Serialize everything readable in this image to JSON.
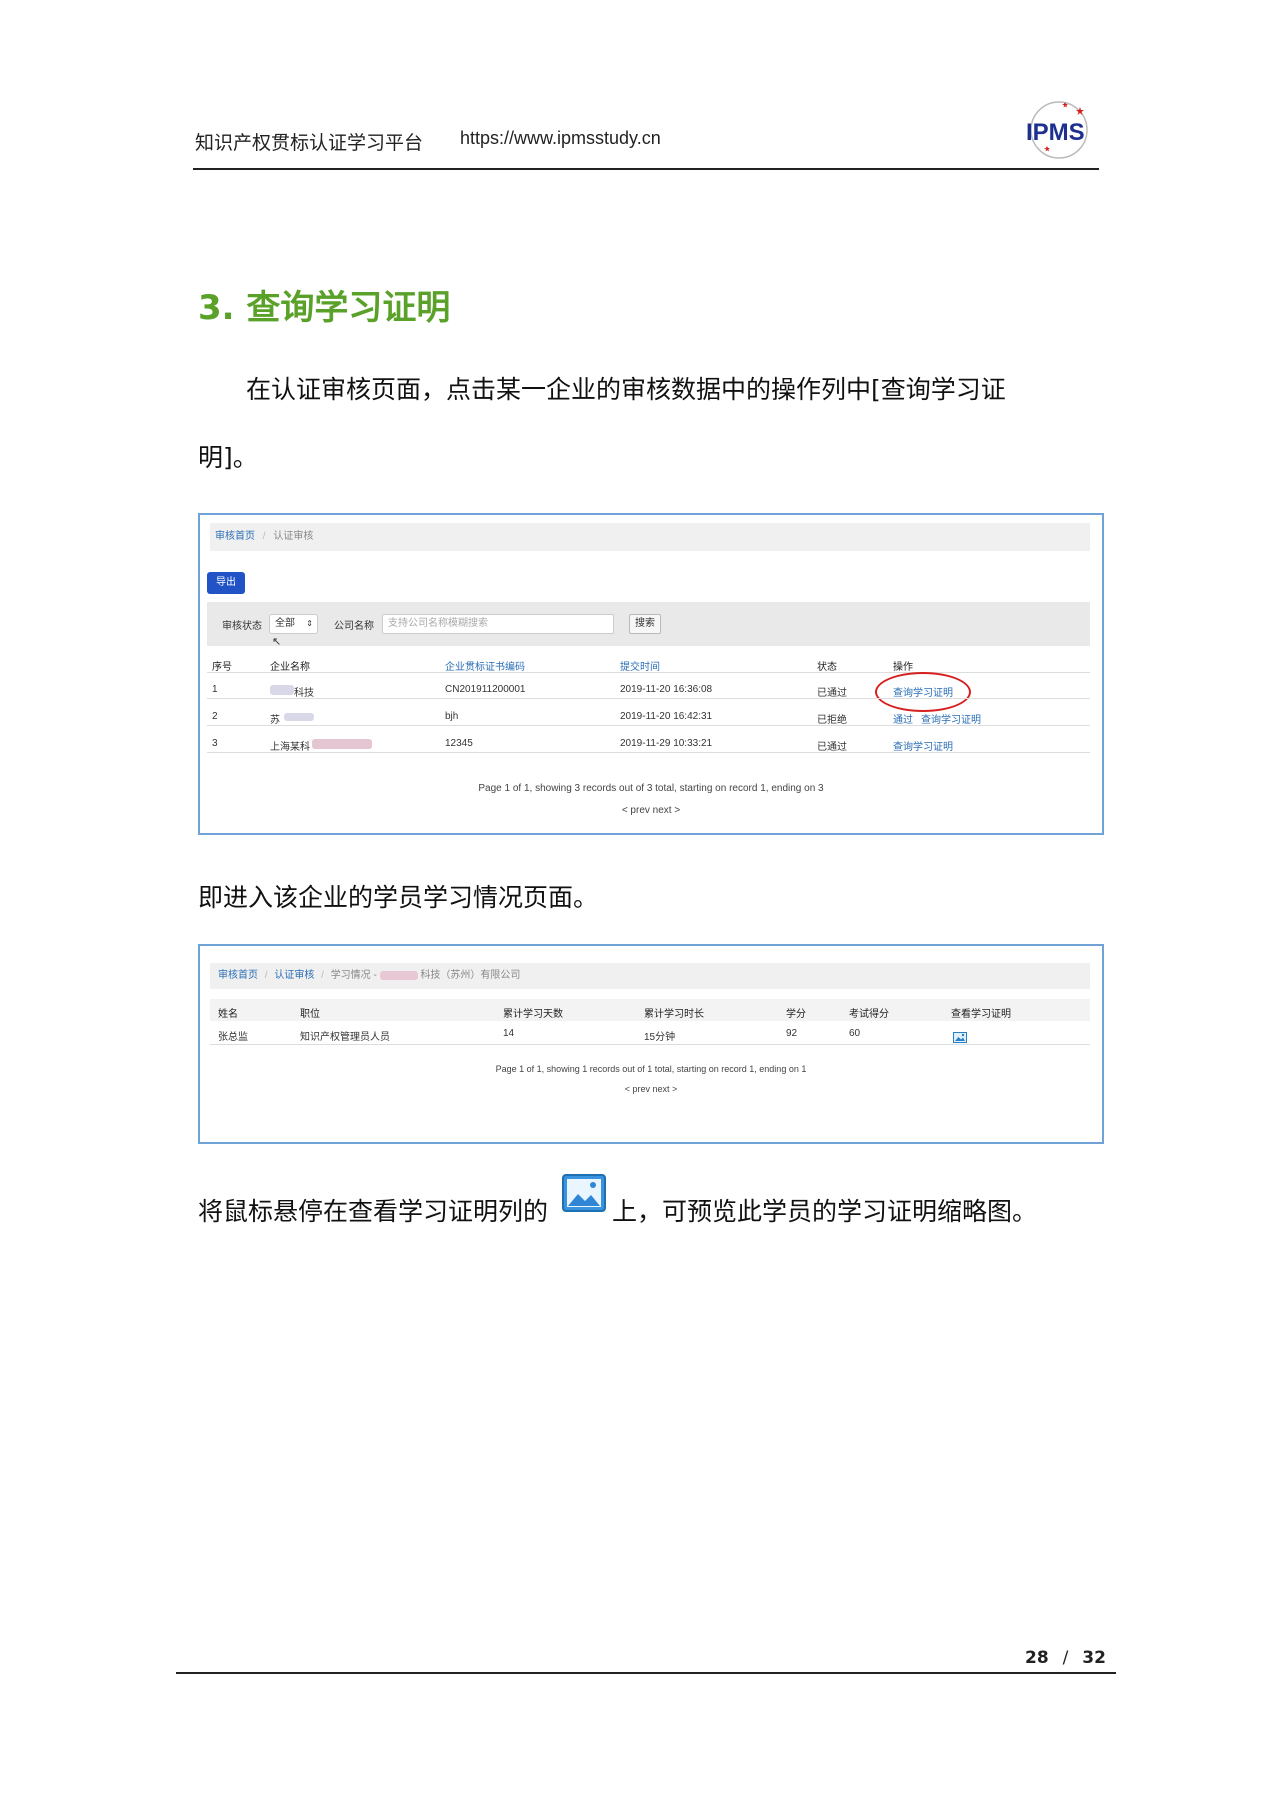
{
  "header": {
    "site_title": "知识产权贯标认证学习平台",
    "url": "https://www.ipmsstudy.cn",
    "logo_text": "IPMS"
  },
  "section": {
    "title": "3. 查询学习证明",
    "para1_line1": "在认证审核页面，点击某一企业的审核数据中的操作列中[查询学习证",
    "para1_line2": "明]。",
    "para2": "即进入该企业的学员学习情况页面。",
    "para3_before": "将鼠标悬停在查看学习证明列的",
    "para3_after": "上，可预览此学员的学习证明缩略图。"
  },
  "shot1": {
    "breadcrumb": {
      "home": "审核首页",
      "sep": "/",
      "current": "认证审核"
    },
    "export_label": "导出",
    "filter": {
      "status_label": "审核状态",
      "status_value": "全部",
      "company_label": "公司名称",
      "company_placeholder": "支持公司名称模糊搜索",
      "search_label": "搜索"
    },
    "columns": [
      "序号",
      "企业名称",
      "企业贯标证书编码",
      "提交时间",
      "状态",
      "操作"
    ],
    "rows": [
      {
        "no": "1",
        "company": "科技",
        "code": "CN201911200001",
        "time": "2019-11-20 16:36:08",
        "status": "已通过",
        "actions": [
          "查询学习证明"
        ]
      },
      {
        "no": "2",
        "company": "苏",
        "code": "bjh",
        "time": "2019-11-20 16:42:31",
        "status": "已拒绝",
        "actions": [
          "通过",
          "查询学习证明"
        ]
      },
      {
        "no": "3",
        "company": "上海某科",
        "code": "12345",
        "time": "2019-11-29 10:33:21",
        "status": "已通过",
        "actions": [
          "查询学习证明"
        ]
      }
    ],
    "pager_text": "Page 1 of 1, showing 3 records out of 3 total, starting on record 1, ending on 3",
    "pager_nav": "< prev next >"
  },
  "shot2": {
    "breadcrumb": {
      "home": "审核首页",
      "sep": "/",
      "mid": "认证审核",
      "current_prefix": "学习情况 -",
      "current_suffix": "科技（苏州）有限公司"
    },
    "columns": [
      "姓名",
      "职位",
      "累计学习天数",
      "累计学习时长",
      "学分",
      "考试得分",
      "查看学习证明"
    ],
    "rows": [
      {
        "name": "张总监",
        "position": "知识产权管理员人员",
        "days": "14",
        "duration": "15分钟",
        "credits": "92",
        "score": "60"
      }
    ],
    "pager_text": "Page 1 of 1, showing 1 records out of 1 total, starting on record 1, ending on 1",
    "pager_nav": "< prev next >"
  },
  "footer": {
    "page_current": "28",
    "page_sep": "/",
    "page_total": "32"
  },
  "colors": {
    "section_title": "#5aa12a",
    "link": "#2a6db5",
    "export_button": "#2153c7",
    "highlight_oval": "#d62020",
    "frame_border": "#6fa2d6"
  }
}
